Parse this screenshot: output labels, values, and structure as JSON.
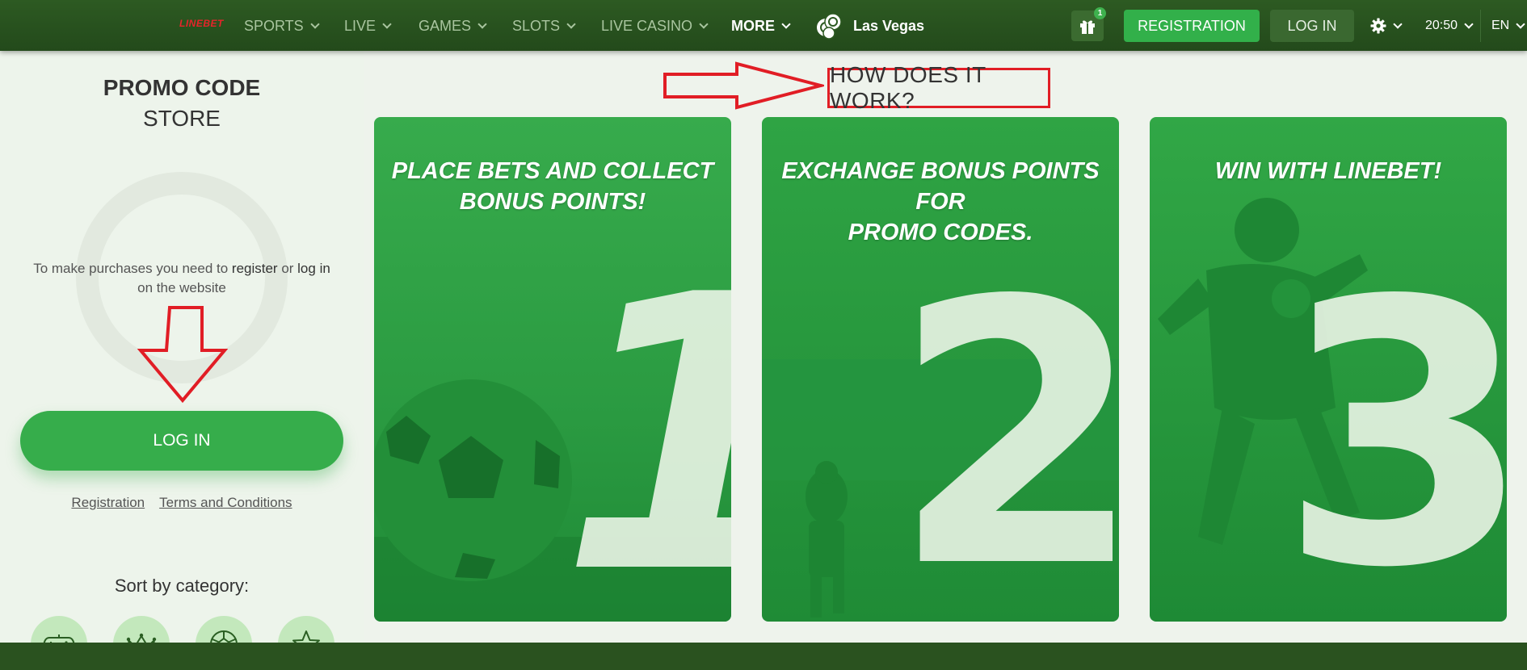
{
  "nav": {
    "logo": "LINEBET",
    "items": [
      {
        "label": "SPORTS"
      },
      {
        "label": "LIVE"
      },
      {
        "label": "GAMES"
      },
      {
        "label": "SLOTS"
      },
      {
        "label": "LIVE CASINO"
      },
      {
        "label": "MORE"
      }
    ],
    "las_vegas": "Las Vegas",
    "gift_count": "1",
    "registration": "REGISTRATION",
    "login": "LOG IN",
    "time": "20:50",
    "language": "EN"
  },
  "sidebar": {
    "title_line1": "PROMO CODE",
    "title_line2": "STORE",
    "purchase_prefix": "To make purchases you need to ",
    "purchase_register": "register",
    "purchase_or": " or ",
    "purchase_login": "log in",
    "purchase_suffix": "on the website",
    "login_button": "LOG IN",
    "link_registration": "Registration",
    "link_terms": "Terms and Conditions",
    "sort_label": "Sort by category:",
    "categories": [
      "gamepad-icon",
      "crown-icon",
      "soccer-ball-icon",
      "star-icon"
    ]
  },
  "main": {
    "how_title": "HOW DOES IT WORK?",
    "steps": [
      {
        "caption_line1": "PLACE BETS AND COLLECT",
        "caption_line2": "BONUS POINTS!",
        "number": "1"
      },
      {
        "caption_line1": "EXCHANGE BONUS POINTS FOR",
        "caption_line2": "PROMO CODES.",
        "number": "2"
      },
      {
        "caption_line1": "WIN WITH LINEBET!",
        "caption_line2": "",
        "number": "3"
      }
    ]
  },
  "colors": {
    "nav_bg": "#2d5a22",
    "accent_green": "#32b04a",
    "card_green": "#2fa444",
    "annotation_red": "#e11d25"
  }
}
